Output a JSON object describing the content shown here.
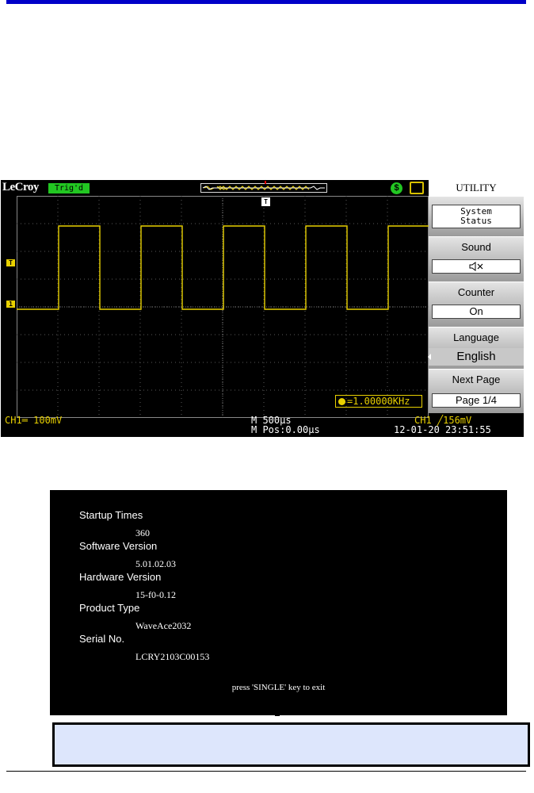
{
  "scope": {
    "brand": "LeCroy",
    "trigger_status": "Trig'd",
    "trigger_marker": "T",
    "channel_marker": "1",
    "frequency": "=1.00000KHz",
    "ch1_scale": "CH1═ 100mV",
    "timebase": "M 500μs",
    "time_position": "M Pos:0.00μs",
    "trigger_info": "CH1 ╱156mV",
    "datetime": "12-01-20 23:51:55",
    "waveform": {
      "high_level_mv": 300,
      "low_level_mv": 0,
      "trigger_level_mv": 156,
      "frequency_hz": 1000,
      "duty_cycle": 0.5
    },
    "colors": {
      "trace": "#e8d000",
      "status_green": "#22c722",
      "grid": "#5a5a5a"
    }
  },
  "menu": {
    "title": "UTILITY",
    "system_status": "System\nStatus",
    "sound_label": "Sound",
    "sound_icon": "speaker-muted-icon",
    "counter_label": "Counter",
    "counter_value": "On",
    "language_label": "Language",
    "language_value": "English",
    "next_label": "Next Page",
    "next_value": "Page 1/4"
  },
  "system_info": {
    "startup_label": "Startup Times",
    "startup_value": "360",
    "software_label": "Software Version",
    "software_value": "5.01.02.03",
    "hardware_label": "Hardware Version",
    "hardware_value": "15-f0-0.12",
    "product_label": "Product Type",
    "product_value": "WaveAce2032",
    "serial_label": "Serial No.",
    "serial_value": "LCRY2103C00153",
    "exit_hint": "press 'SINGLE' key to exit"
  }
}
